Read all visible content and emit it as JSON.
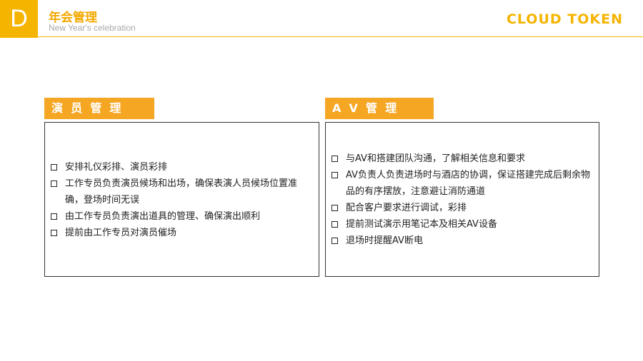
{
  "header": {
    "badge": "D",
    "title": "年会管理",
    "subtitle": "New Year's celebration",
    "brand": "CLOUD TOKEN"
  },
  "colors": {
    "accent": "#f5b400",
    "label_bg": "#f5a623"
  },
  "sections": [
    {
      "label": "演  员  管  理",
      "items": [
        "安排礼仪彩排、演员彩排",
        "工作专员负责演员候场和出场，确保表演人员候场位置准确，登场时间无误",
        "由工作专员负责演出道具的管理、确保演出顺利",
        "提前由工作专员对演员催场"
      ]
    },
    {
      "label": "A  V  管  理",
      "items": [
        "与AV和搭建团队沟通，了解相关信息和要求",
        "AV负责人负责进场时与酒店的协调，保证搭建完成后剩余物品的有序摆放，注意避让消防通道",
        "配合客户要求进行调试，彩排",
        "提前测试演示用笔记本及相关AV设备",
        "退场时提醒AV断电"
      ]
    }
  ]
}
